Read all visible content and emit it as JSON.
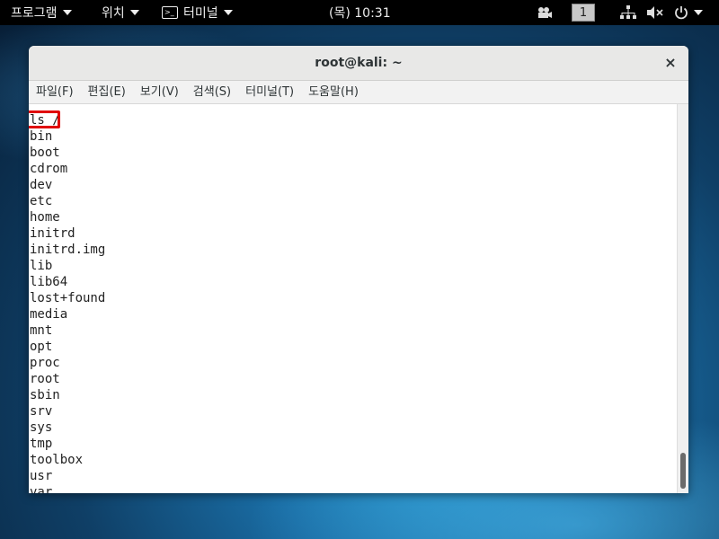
{
  "topbar": {
    "activities": "프로그램",
    "places": "위치",
    "app": "터미널",
    "clock": "(목) 10:31",
    "workspace": "1"
  },
  "window": {
    "title": "root@kali: ~",
    "close": "×"
  },
  "menu": [
    "파일(F)",
    "편집(E)",
    "보기(V)",
    "검색(S)",
    "터미널(T)",
    "도움말(H)"
  ],
  "terminal": {
    "lines": [
      "ls /",
      "bin",
      "boot",
      "cdrom",
      "dev",
      "etc",
      "home",
      "initrd",
      "initrd.img",
      "lib",
      "lib64",
      "lost+found",
      "media",
      "mnt",
      "opt",
      "proc",
      "root",
      "sbin",
      "srv",
      "sys",
      "tmp",
      "toolbox",
      "usr",
      "var"
    ]
  }
}
